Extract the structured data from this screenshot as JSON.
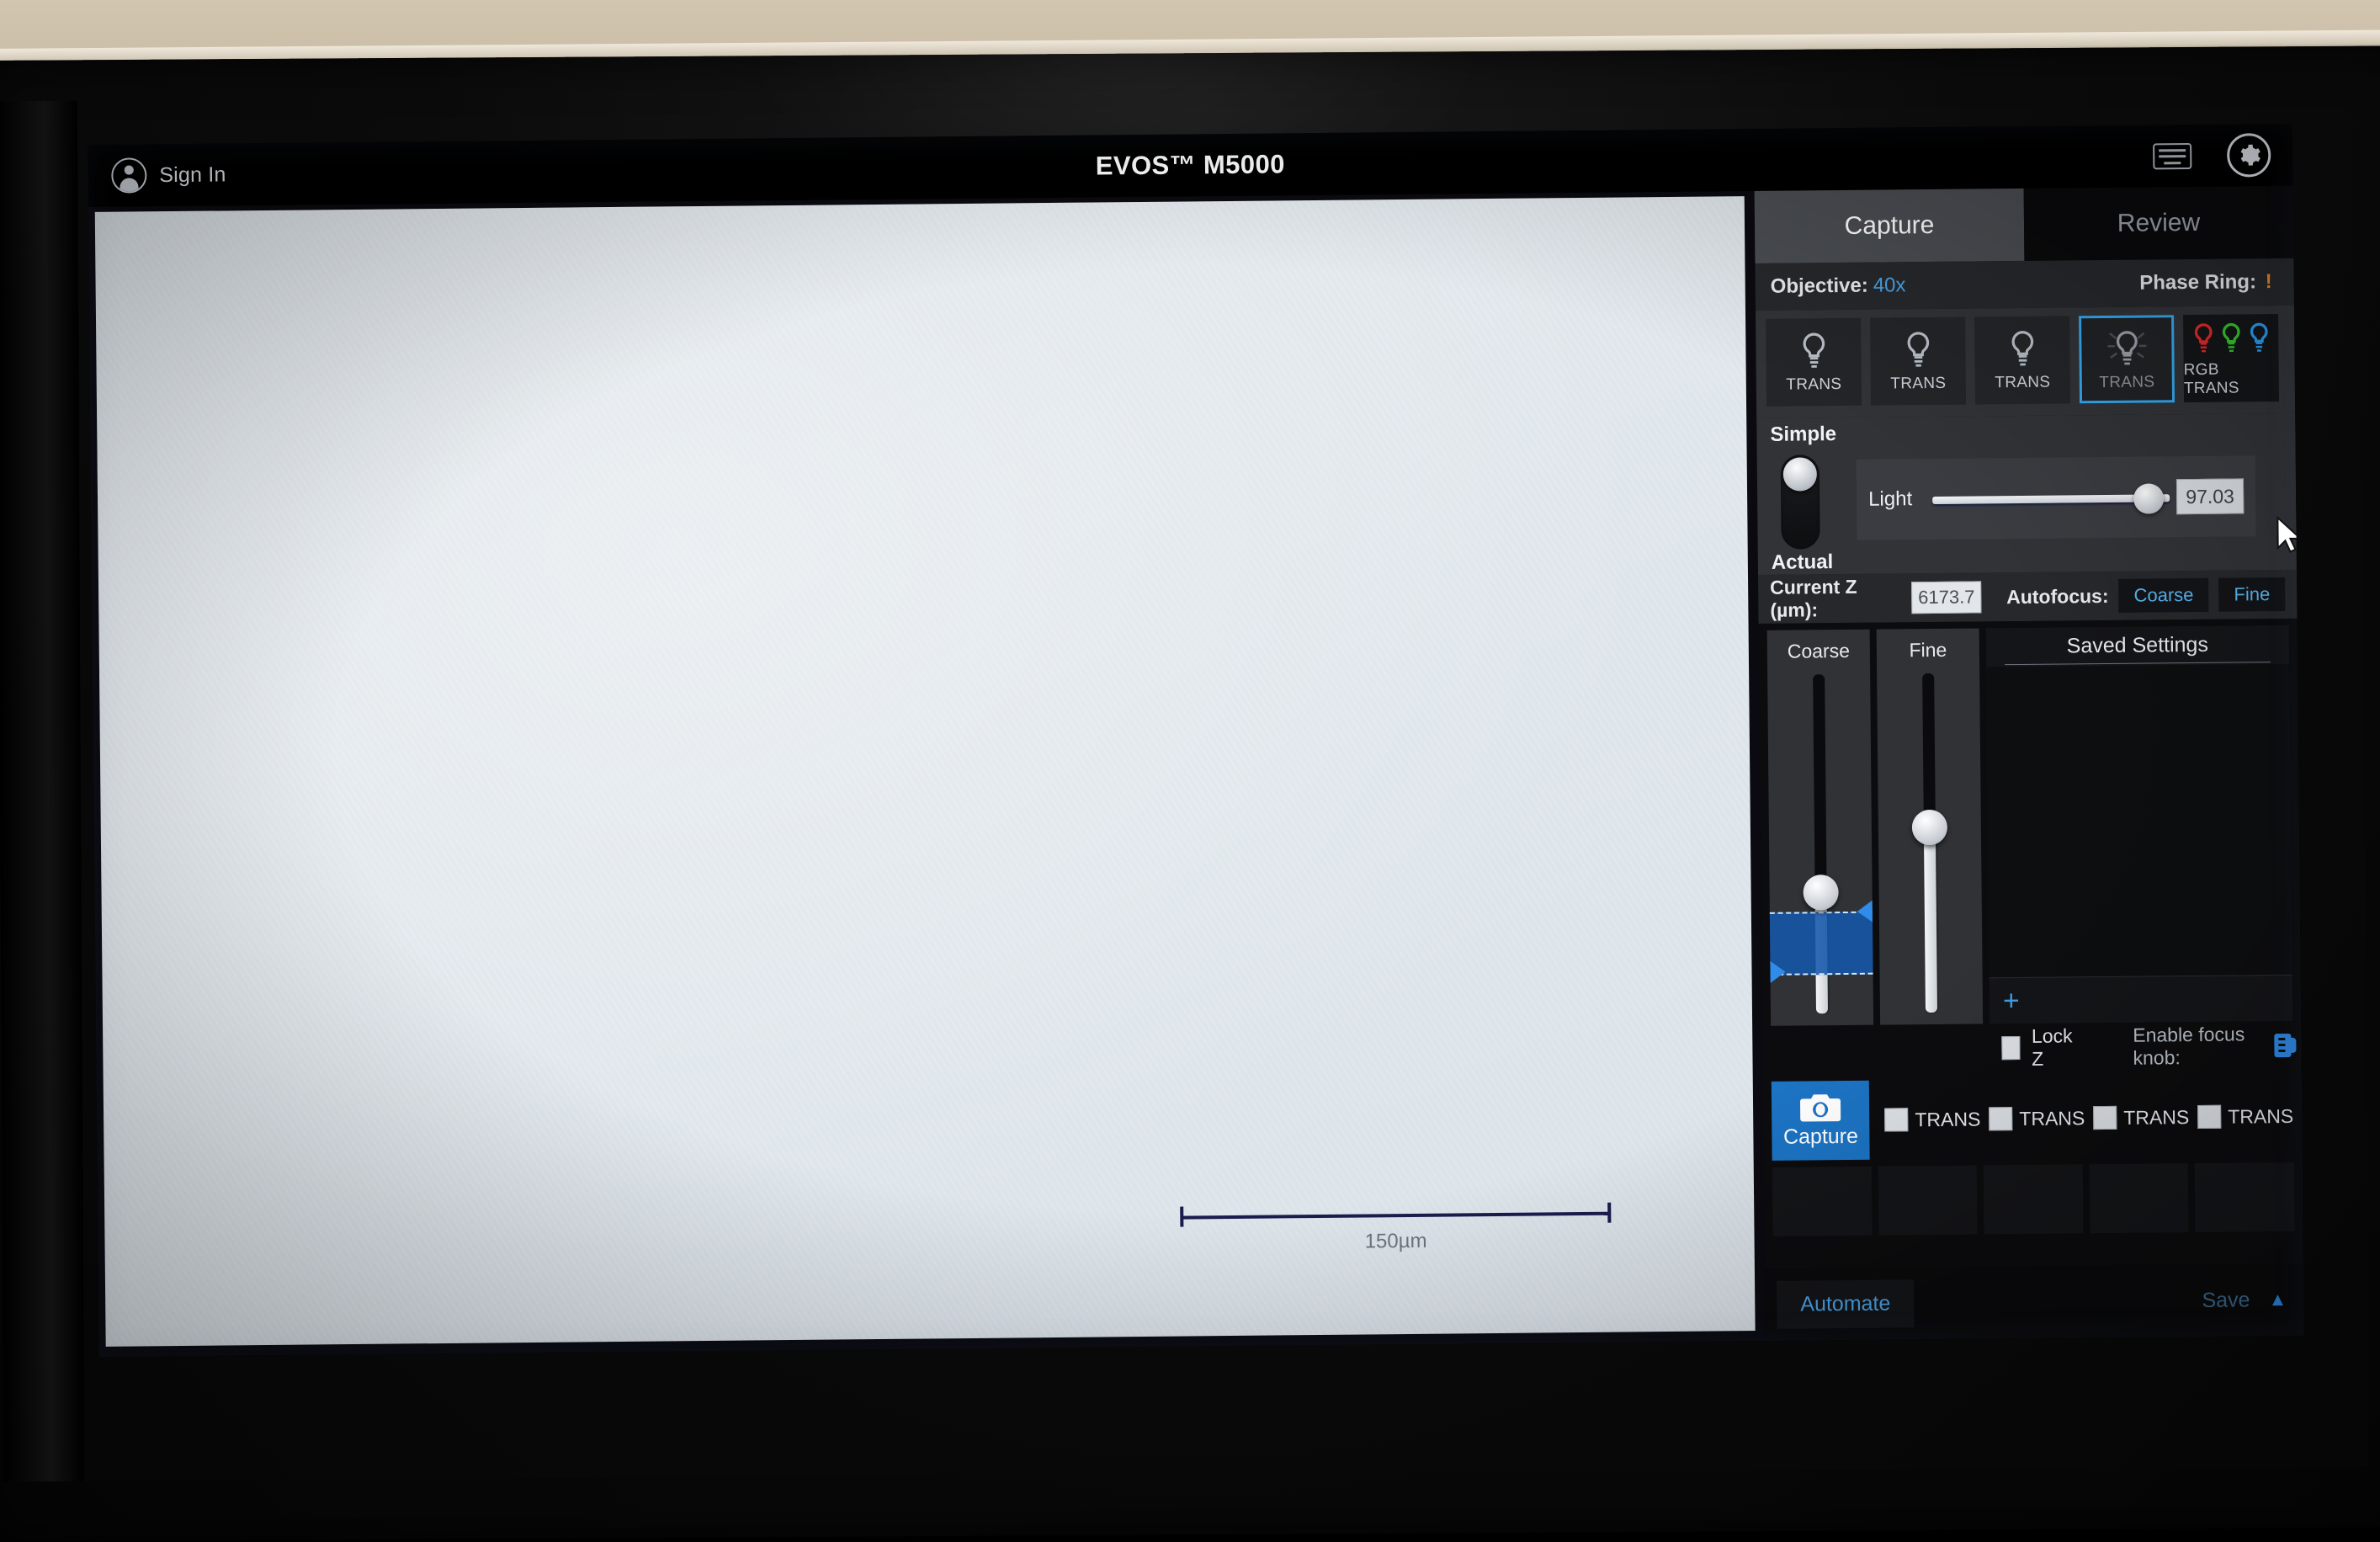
{
  "titlebar": {
    "signin_label": "Sign In",
    "app_title": "EVOS™ M5000",
    "avatar_icon": "account-avatar-icon",
    "keyboard_icon": "keyboard-icon",
    "gear_icon": "gear-icon"
  },
  "tabs": [
    {
      "label": "Capture",
      "active": true
    },
    {
      "label": "Review",
      "active": false
    }
  ],
  "status": {
    "objective_label": "Objective:",
    "objective_value": "40x",
    "phase_ring_label": "Phase Ring:",
    "phase_ring_value": "!"
  },
  "channels": [
    {
      "label": "TRANS",
      "icon": "light-bulb-icon",
      "selected": false
    },
    {
      "label": "TRANS",
      "icon": "light-bulb-icon",
      "selected": false
    },
    {
      "label": "TRANS",
      "icon": "light-bulb-icon",
      "selected": false
    },
    {
      "label": "TRANS",
      "icon": "light-bulb-icon",
      "selected": true
    },
    {
      "label": "RGB TRANS",
      "icon": "rgb-light-bulbs-icon",
      "selected": false
    }
  ],
  "illumination": {
    "mode_top_label": "Simple",
    "mode_bottom_label": "Actual",
    "mode_selected": "Simple",
    "light_label": "Light",
    "light_value": "97.03",
    "light_percent": 97
  },
  "zfocus": {
    "current_z_label": "Current Z (µm):",
    "current_z_value": "6173.7",
    "autofocus_label": "Autofocus:",
    "autofocus_coarse": "Coarse",
    "autofocus_fine": "Fine",
    "coarse_label": "Coarse",
    "fine_label": "Fine",
    "coarse_percent": 66,
    "fine_percent": 45,
    "lock_z_label": "Lock Z",
    "lock_z_checked": false,
    "enable_focus_knob_label": "Enable focus knob:",
    "focus_knob_icon": "focus-knob-icon"
  },
  "saved_settings": {
    "title": "Saved Settings",
    "items": [],
    "add_label": "+"
  },
  "capture": {
    "button_label": "Capture",
    "camera_icon": "camera-icon",
    "channel_checkboxes": [
      {
        "label": "TRANS",
        "checked": false
      },
      {
        "label": "TRANS",
        "checked": false
      },
      {
        "label": "TRANS",
        "checked": false
      },
      {
        "label": "TRANS",
        "checked": false
      }
    ],
    "thumbnail_slots": [
      "",
      "",
      "",
      "",
      ""
    ]
  },
  "footer": {
    "automate_label": "Automate",
    "save_label": "Save",
    "save_caret": "▲"
  },
  "viewport": {
    "scalebar_label": "150µm"
  },
  "colors": {
    "accent_blue": "#2f8ce8",
    "capture_blue": "#1c74c4",
    "warn_orange": "#e8872a",
    "panel_bg": "#0c0c0e",
    "panel_section": "#313337",
    "tab_active_bg": "#4a4d52"
  }
}
